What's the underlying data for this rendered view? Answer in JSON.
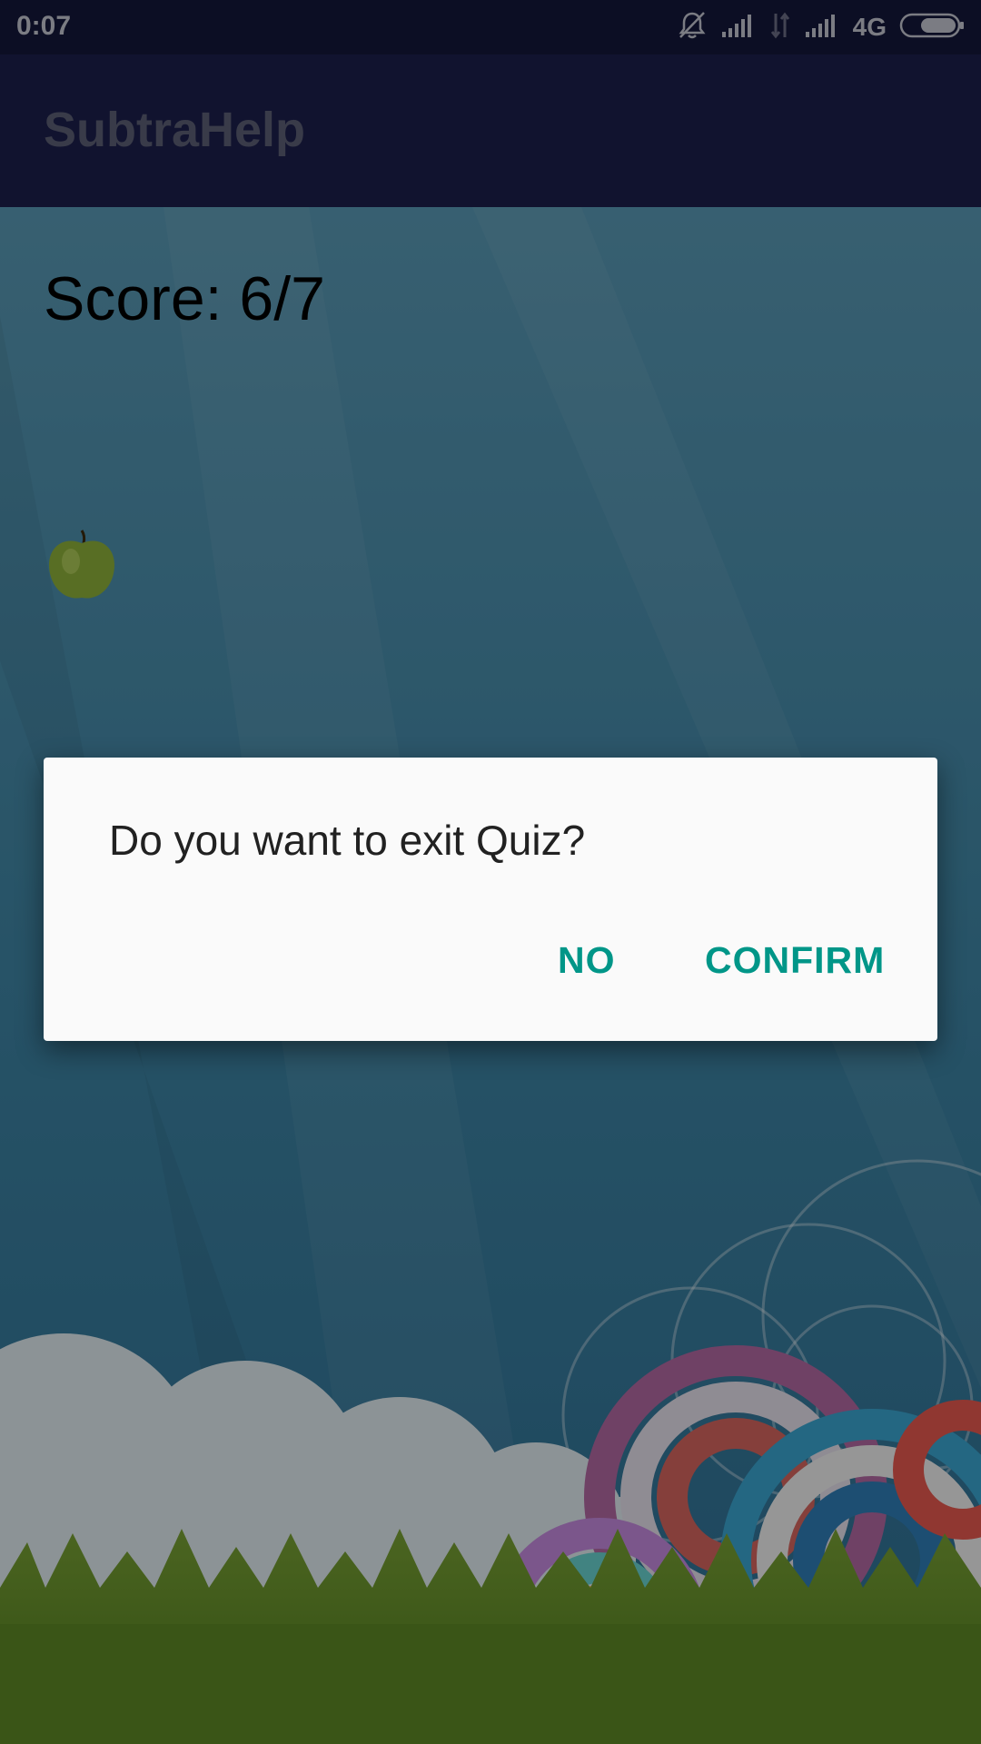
{
  "status_bar": {
    "time": "0:07",
    "network": "4G",
    "icons": [
      "notifications-off-icon",
      "signal-icon",
      "data-transfer-icon",
      "signal-icon",
      "battery-icon"
    ]
  },
  "app_bar": {
    "title": "SubtraHelp"
  },
  "quiz": {
    "score": "Score: 6/7",
    "item_icon": "apple-icon"
  },
  "dialog": {
    "message": "Do you want to exit Quiz?",
    "no_label": "NO",
    "confirm_label": "CONFIRM"
  },
  "colors": {
    "status_bar": "#14173a",
    "app_bar": "#1c1f4c",
    "dialog_bg": "#fafafa",
    "accent": "#009688"
  }
}
